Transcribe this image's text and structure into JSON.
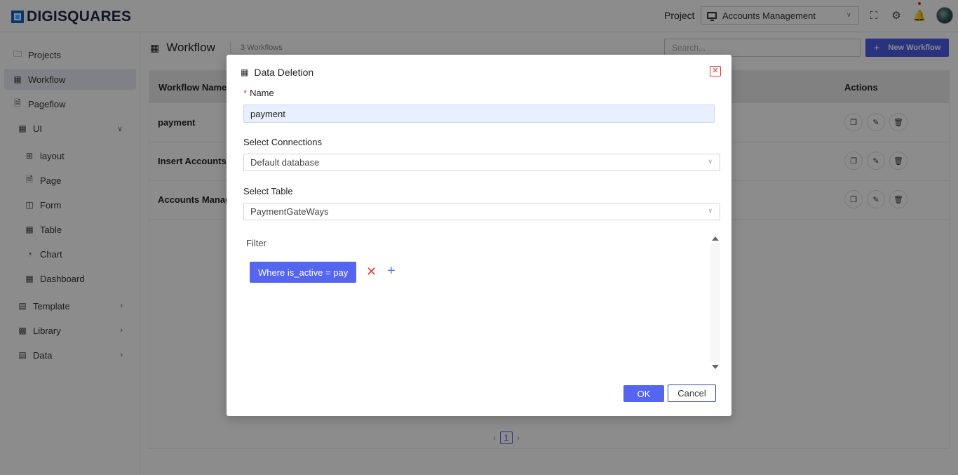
{
  "header": {
    "brand": "DIGISQUARES",
    "project_label": "Project",
    "project_value": "Accounts Management"
  },
  "sidebar": {
    "items": [
      {
        "label": "Projects",
        "icon": "folder-icon"
      },
      {
        "label": "Workflow",
        "icon": "workflow-icon"
      },
      {
        "label": "Pageflow",
        "icon": "pageflow-icon"
      },
      {
        "label": "UI",
        "icon": "ui-icon"
      },
      {
        "label": "layout",
        "icon": "layout-icon"
      },
      {
        "label": "Page",
        "icon": "page-icon"
      },
      {
        "label": "Form",
        "icon": "form-icon"
      },
      {
        "label": "Table",
        "icon": "table-icon"
      },
      {
        "label": "Chart",
        "icon": "chart-icon"
      },
      {
        "label": "Dashboard",
        "icon": "dashboard-icon"
      },
      {
        "label": "Template",
        "icon": "template-icon"
      },
      {
        "label": "Library",
        "icon": "library-icon"
      },
      {
        "label": "Data",
        "icon": "data-icon"
      }
    ]
  },
  "main": {
    "title": "Workflow",
    "count": "3 Workflows",
    "search_placeholder": "Search...",
    "new_button": "New Workflow",
    "columns": [
      "Workflow Name",
      "Actions"
    ],
    "rows": [
      {
        "name": "payment"
      },
      {
        "name": "Insert Accounts d"
      },
      {
        "name": "Accounts Manag"
      }
    ],
    "page": "1"
  },
  "modal": {
    "title": "Data Deletion",
    "name_label": "Name",
    "name_value": "payment",
    "connections_label": "Select Connections",
    "connections_value": "Default database",
    "table_label": "Select Table",
    "table_value": "PaymentGateWays",
    "filter_label": "Filter",
    "filter_chip": "Where is_active = pay",
    "ok": "OK",
    "cancel": "Cancel"
  },
  "colors": {
    "accent": "#5565f0",
    "danger": "#e53935"
  }
}
